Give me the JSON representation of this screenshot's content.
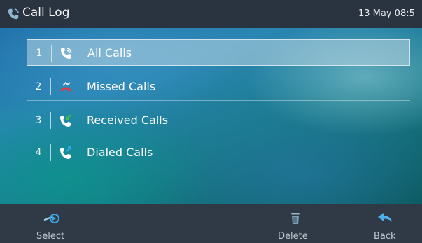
{
  "header": {
    "title": "Call Log",
    "datetime": "13 May 08:5",
    "title_icon": "phone-icon"
  },
  "menu": {
    "selected_index": 0,
    "items": [
      {
        "number": "1",
        "label": "All Calls",
        "icon": "all-calls-icon",
        "icon_color": "#ffffff"
      },
      {
        "number": "2",
        "label": "Missed Calls",
        "icon": "missed-calls-icon",
        "icon_color": "#e23b3b"
      },
      {
        "number": "3",
        "label": "Received Calls",
        "icon": "received-calls-icon",
        "icon_color": "#3fc24b"
      },
      {
        "number": "4",
        "label": "Dialed Calls",
        "icon": "dialed-calls-icon",
        "icon_color": "#2ea6e8"
      }
    ]
  },
  "softkeys": {
    "select": {
      "label": "Select",
      "icon": "select-arrow-icon"
    },
    "delete": {
      "label": "Delete",
      "icon": "trash-icon"
    },
    "back": {
      "label": "Back",
      "icon": "back-arrow-icon"
    }
  },
  "colors": {
    "header_bg": "#2a3340",
    "softbar_bg": "#303a47",
    "selection_bg": "#bed7e4",
    "accent_blue": "#2ea6e8"
  }
}
